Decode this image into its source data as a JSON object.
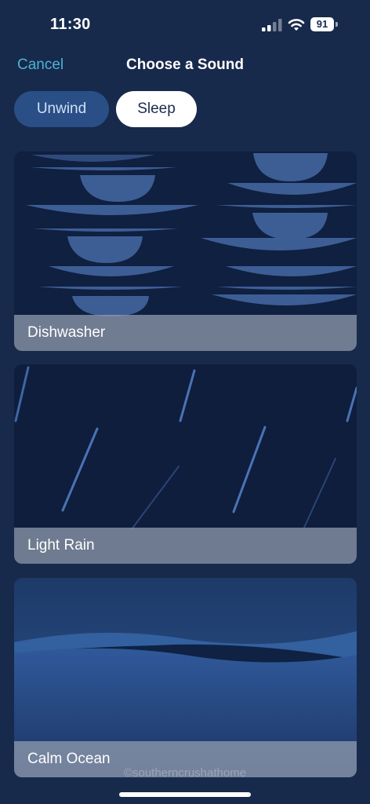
{
  "status_bar": {
    "time": "11:30",
    "battery": "91",
    "icons": [
      "signal-icon",
      "wifi-icon",
      "battery-icon"
    ]
  },
  "header": {
    "cancel_label": "Cancel",
    "title": "Choose a Sound"
  },
  "tabs": [
    {
      "label": "Unwind",
      "selected": false
    },
    {
      "label": "Sleep",
      "selected": true
    }
  ],
  "sounds": [
    {
      "label": "Dishwasher"
    },
    {
      "label": "Light Rain"
    },
    {
      "label": "Calm Ocean"
    }
  ],
  "watermark": "©southerncrushathome",
  "colors": {
    "background": "#172a4c",
    "accent": "#4cb4d2",
    "tab_inactive": "#2a4f86",
    "tab_active": "#ffffff"
  }
}
